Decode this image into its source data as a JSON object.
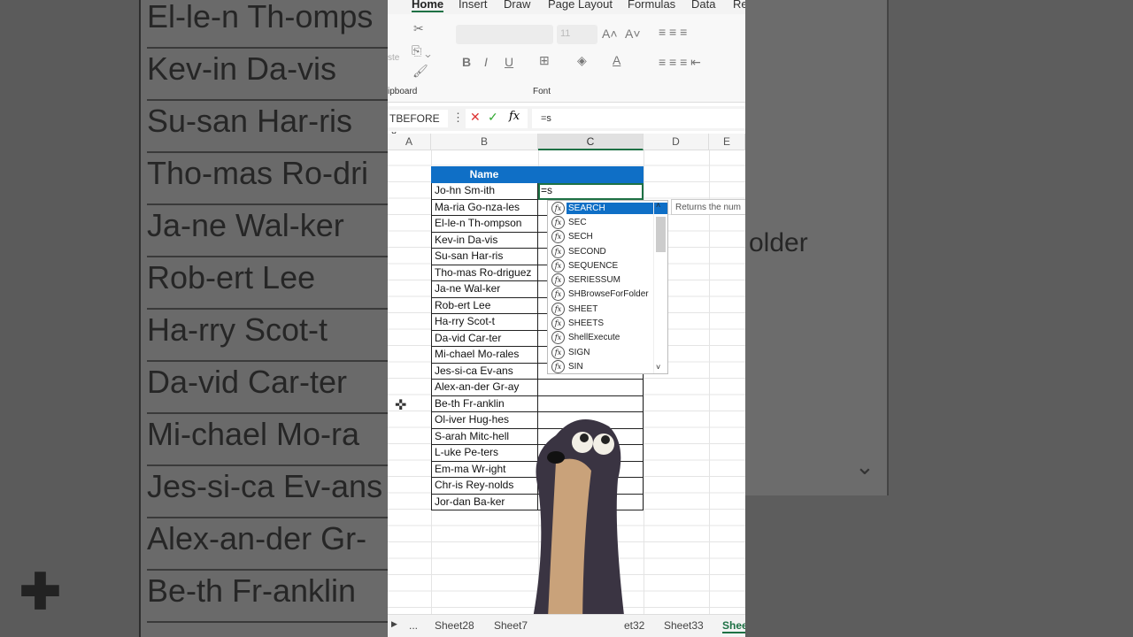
{
  "background": {
    "left_names": [
      "El-le-n Th-omps",
      "Kev-in Da-vis",
      "Su-san Har-ris",
      "Tho-mas Ro-dri",
      "Ja-ne Wal-ker",
      "Rob-ert Lee",
      "Ha-rry Scot-t",
      "Da-vid Car-ter",
      "Mi-chael Mo-ra",
      "Jes-si-ca Ev-ans",
      "Alex-an-der Gr-",
      "Be-th Fr-anklin"
    ],
    "right_text": "older"
  },
  "ribbon": {
    "tabs": [
      "Home",
      "Insert",
      "Draw",
      "Page Layout",
      "Formulas",
      "Data",
      "Re"
    ],
    "active_tab": "Home",
    "font_size": "11",
    "groups": [
      "ipboard",
      "Font"
    ],
    "paste_label": "ste"
  },
  "formula_bar": {
    "name_box": "TBEFORE",
    "formula": "=s"
  },
  "columns": [
    "A",
    "B",
    "C",
    "D",
    "E"
  ],
  "table": {
    "header": "Name",
    "names": [
      "Jo-hn Sm-ith",
      "Ma-ria Go-nza-les",
      "El-le-n Th-ompson",
      "Kev-in Da-vis",
      "Su-san Har-ris",
      "Tho-mas Ro-driguez",
      "Ja-ne Wal-ker",
      "Rob-ert Lee",
      "Ha-rry Scot-t",
      "Da-vid Car-ter",
      "Mi-chael Mo-rales",
      "Jes-si-ca Ev-ans",
      "Alex-an-der Gr-ay",
      "Be-th Fr-anklin",
      "Ol-iver Hug-hes",
      "S-arah Mitc-hell",
      "L-uke Pe-ters",
      "Em-ma Wr-ight",
      "Chr-is Rey-nolds",
      "Jor-dan Ba-ker"
    ],
    "active_cell_value": "=s"
  },
  "autocomplete": {
    "items": [
      "SEARCH",
      "SEC",
      "SECH",
      "SECOND",
      "SEQUENCE",
      "SERIESSUM",
      "SHBrowseForFolder",
      "SHEET",
      "SHEETS",
      "ShellExecute",
      "SIGN",
      "SIN"
    ],
    "selected": "SEARCH",
    "fx_label": "fx"
  },
  "tooltip": "Returns the num",
  "sheet_tabs": [
    "...",
    "Sheet28",
    "Sheet7",
    "et32",
    "Sheet33",
    "Shee"
  ],
  "colors": {
    "accent": "#0f6fc6",
    "excel_green": "#1e7145"
  }
}
